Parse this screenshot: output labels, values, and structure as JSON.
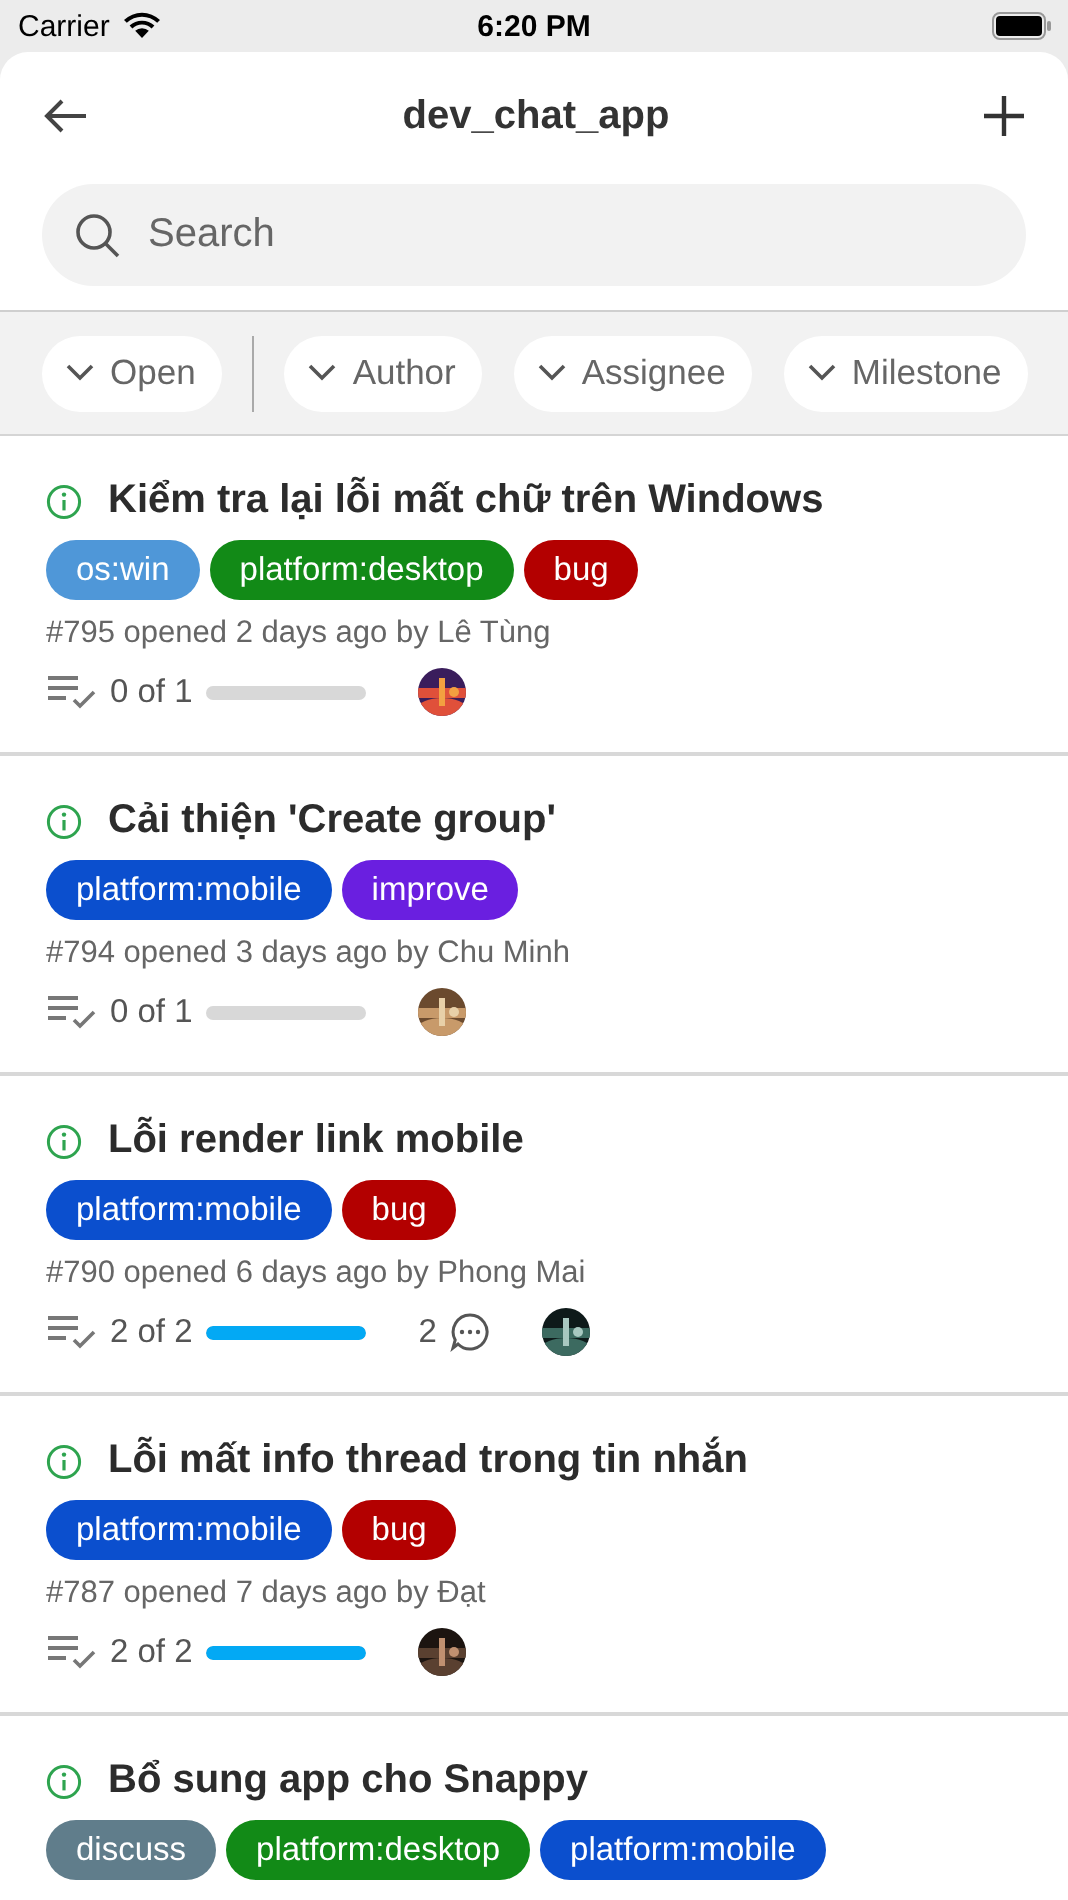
{
  "status_bar": {
    "carrier": "Carrier",
    "time": "6:20 PM"
  },
  "header": {
    "title": "dev_chat_app"
  },
  "search": {
    "placeholder": "Search"
  },
  "filters": [
    {
      "label": "Open",
      "kind": "state"
    },
    {
      "label": "Author",
      "kind": "filter"
    },
    {
      "label": "Assignee",
      "kind": "filter"
    },
    {
      "label": "Milestone",
      "kind": "filter"
    }
  ],
  "issues": [
    {
      "title": "Kiểm tra lại lỗi mất chữ trên Windows",
      "labels": [
        {
          "text": "os:win",
          "color": "#4f97d8"
        },
        {
          "text": "platform:desktop",
          "color": "#128a17"
        },
        {
          "text": "bug",
          "color": "#b30000"
        }
      ],
      "meta": "#795 opened 2 days ago by Lê Tùng",
      "tasks": "0 of 1",
      "level": 0,
      "avatar": {
        "kind": "picture"
      }
    },
    {
      "title": "Cải thiện 'Create group'",
      "labels": [
        {
          "text": "platform:mobile",
          "color": "#0b4fce"
        },
        {
          "text": "improve",
          "color": "#6a1fe0"
        }
      ],
      "meta": "#794 opened 3 days ago by Chu Minh",
      "tasks": "0 of 1",
      "level": 0,
      "avatar": {
        "kind": "picture"
      }
    },
    {
      "title": "Lỗi render link mobile",
      "labels": [
        {
          "text": "platform:mobile",
          "color": "#0b4fce"
        },
        {
          "text": "bug",
          "color": "#b30000"
        }
      ],
      "meta": "#790 opened 6 days ago by Phong Mai",
      "tasks": "2 of 2",
      "level": 1,
      "comments": "2",
      "avatar": {
        "kind": "picture"
      }
    },
    {
      "title": "Lỗi mất info thread trong tin nhắn",
      "labels": [
        {
          "text": "platform:mobile",
          "color": "#0b4fce"
        },
        {
          "text": "bug",
          "color": "#b30000"
        }
      ],
      "meta": "#787 opened 7 days ago by Đạt",
      "tasks": "2 of 2",
      "level": 1,
      "avatar": {
        "kind": "picture"
      }
    },
    {
      "title": "Bổ sung app cho Snappy",
      "labels": [
        {
          "text": "discuss",
          "color": "#607d8b"
        },
        {
          "text": "platform:desktop",
          "color": "#128a17"
        },
        {
          "text": "platform:mobile",
          "color": "#0b4fce"
        }
      ]
    }
  ]
}
